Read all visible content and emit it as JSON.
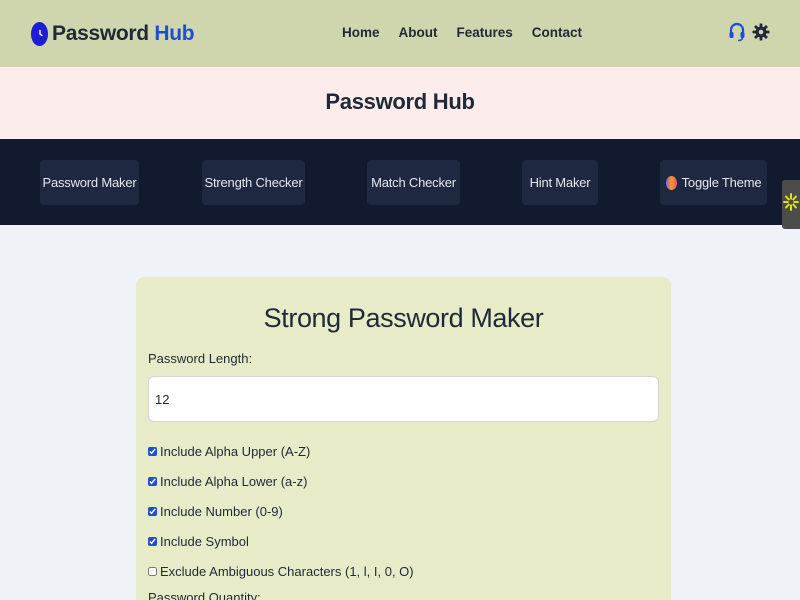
{
  "header": {
    "logo": {
      "word1": "Password",
      "word2": "Hub"
    },
    "nav": [
      "Home",
      "About",
      "Features",
      "Contact"
    ]
  },
  "banner": {
    "title": "Password Hub"
  },
  "toolbar": {
    "buttons": [
      "Password Maker",
      "Strength Checker",
      "Match Checker",
      "Hint Maker",
      "Toggle Theme"
    ]
  },
  "card": {
    "title": "Strong Password Maker",
    "length_label": "Password Length:",
    "length_value": "12",
    "options": [
      {
        "label": "Include Alpha Upper (A-Z)",
        "checked": true
      },
      {
        "label": "Include Alpha Lower (a-z)",
        "checked": true
      },
      {
        "label": "Include Number (0-9)",
        "checked": true
      },
      {
        "label": "Include Symbol",
        "checked": true
      },
      {
        "label": "Exclude Ambiguous Characters (1, l, I, 0, O)",
        "checked": false
      }
    ],
    "quantity_label": "Password Quantity:"
  },
  "colors": {
    "topnav_bg": "#cfd6ae",
    "banner_bg": "#fdecec",
    "toolbar_bg": "#111a2e",
    "card_bg": "#e7ebc8",
    "accent": "#1d4ed8"
  }
}
